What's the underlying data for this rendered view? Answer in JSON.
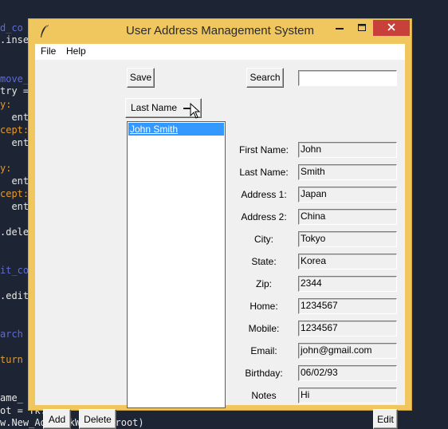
{
  "background_code": {
    "lines": [
      {
        "text": "d_co",
        "color": "#5f6bd6"
      },
      {
        "text": ".inse",
        "color": "#e8e8e8"
      },
      {
        "text": "move_",
        "color": "#5f6bd6"
      },
      {
        "text": "try =",
        "color": "#e8e8e8"
      },
      {
        "text": "y:",
        "color": "#e59a2a"
      },
      {
        "text": "  ent",
        "color": "#e8e8e8"
      },
      {
        "text": "cept:",
        "color": "#e59a2a"
      },
      {
        "text": "  ent",
        "color": "#e8e8e8"
      },
      {
        "text": "y:",
        "color": "#e59a2a"
      },
      {
        "text": "  ent",
        "color": "#e8e8e8"
      },
      {
        "text": "cept:",
        "color": "#e59a2a"
      },
      {
        "text": "  ent",
        "color": "#e8e8e8"
      },
      {
        "text": ".dele",
        "color": "#e8e8e8"
      },
      {
        "text": "it_co",
        "color": "#5f6bd6"
      },
      {
        "text": ".edit",
        "color": "#e8e8e8"
      },
      {
        "text": "arch",
        "color": "#5f6bd6"
      },
      {
        "text": "turn",
        "color": "#e59a2a"
      },
      {
        "text": "ame_",
        "color": "#e8e8e8"
      },
      {
        "text": "ot = Tk.Tk()",
        "color": "#e8e8e8"
      },
      {
        "text": "w.New_AddBookWindow(root)",
        "color": "#e8e8e8"
      }
    ]
  },
  "window": {
    "title": "User Address Management System",
    "controls": {
      "minimize": "minimize-icon",
      "maximize": "maximize-icon",
      "close": "close-icon"
    },
    "colors": {
      "frame": "#f0c75e",
      "close": "#c7403a",
      "client": "#f0f0f0",
      "selection": "#3399ff"
    }
  },
  "menu": {
    "items": [
      "File",
      "Help"
    ]
  },
  "toolbar": {
    "save_label": "Save",
    "search_label": "Search",
    "search_value": ""
  },
  "sort_menu": {
    "selected": "Last Name"
  },
  "contacts": {
    "items": [
      "John Smith"
    ],
    "selected_index": 0
  },
  "form": {
    "fields": [
      {
        "label": "First Name:",
        "value": "John"
      },
      {
        "label": "Last Name:",
        "value": "Smith"
      },
      {
        "label": "Address 1:",
        "value": "Japan"
      },
      {
        "label": "Address 2:",
        "value": "China"
      },
      {
        "label": "City:",
        "value": "Tokyo"
      },
      {
        "label": "State:",
        "value": "Korea"
      },
      {
        "label": "Zip:",
        "value": "2344"
      },
      {
        "label": "Home:",
        "value": "1234567"
      },
      {
        "label": "Mobile:",
        "value": "1234567"
      },
      {
        "label": "Email:",
        "value": "john@gmail.com"
      },
      {
        "label": "Birthday:",
        "value": "06/02/93"
      },
      {
        "label": "Notes",
        "value": "Hi"
      }
    ]
  },
  "buttons": {
    "add_label": "Add",
    "delete_label": "Delete",
    "edit_label": "Edit"
  }
}
